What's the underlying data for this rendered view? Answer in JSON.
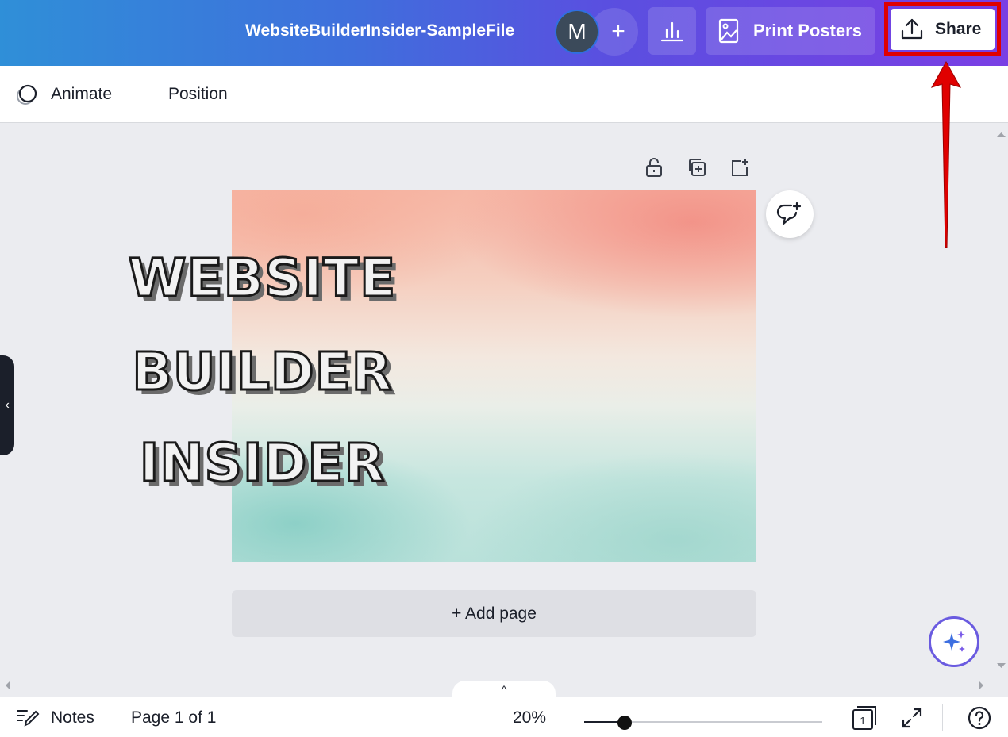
{
  "header": {
    "doc_title": "WebsiteBuilderInsider-SampleFile",
    "avatar_initial": "M",
    "add_collaborator": "+",
    "print_label": "Print Posters",
    "share_label": "Share"
  },
  "toolbar": {
    "animate_label": "Animate",
    "position_label": "Position"
  },
  "design": {
    "lines": [
      "WEBSITE",
      "BUILDER",
      "INSIDER"
    ]
  },
  "canvas": {
    "add_page_label": "+ Add page",
    "pages_toggle": "^"
  },
  "sidebar": {
    "collapse_glyph": "‹"
  },
  "footer": {
    "notes_label": "Notes",
    "page_indicator": "Page 1 of 1",
    "zoom_label": "20%",
    "zoom_value": 0.17,
    "page_count": "1"
  },
  "annotation": {
    "highlight_color": "#e00000"
  },
  "colors": {
    "accent": "#7a3fe4",
    "brand_blue": "#2f8fd8"
  }
}
